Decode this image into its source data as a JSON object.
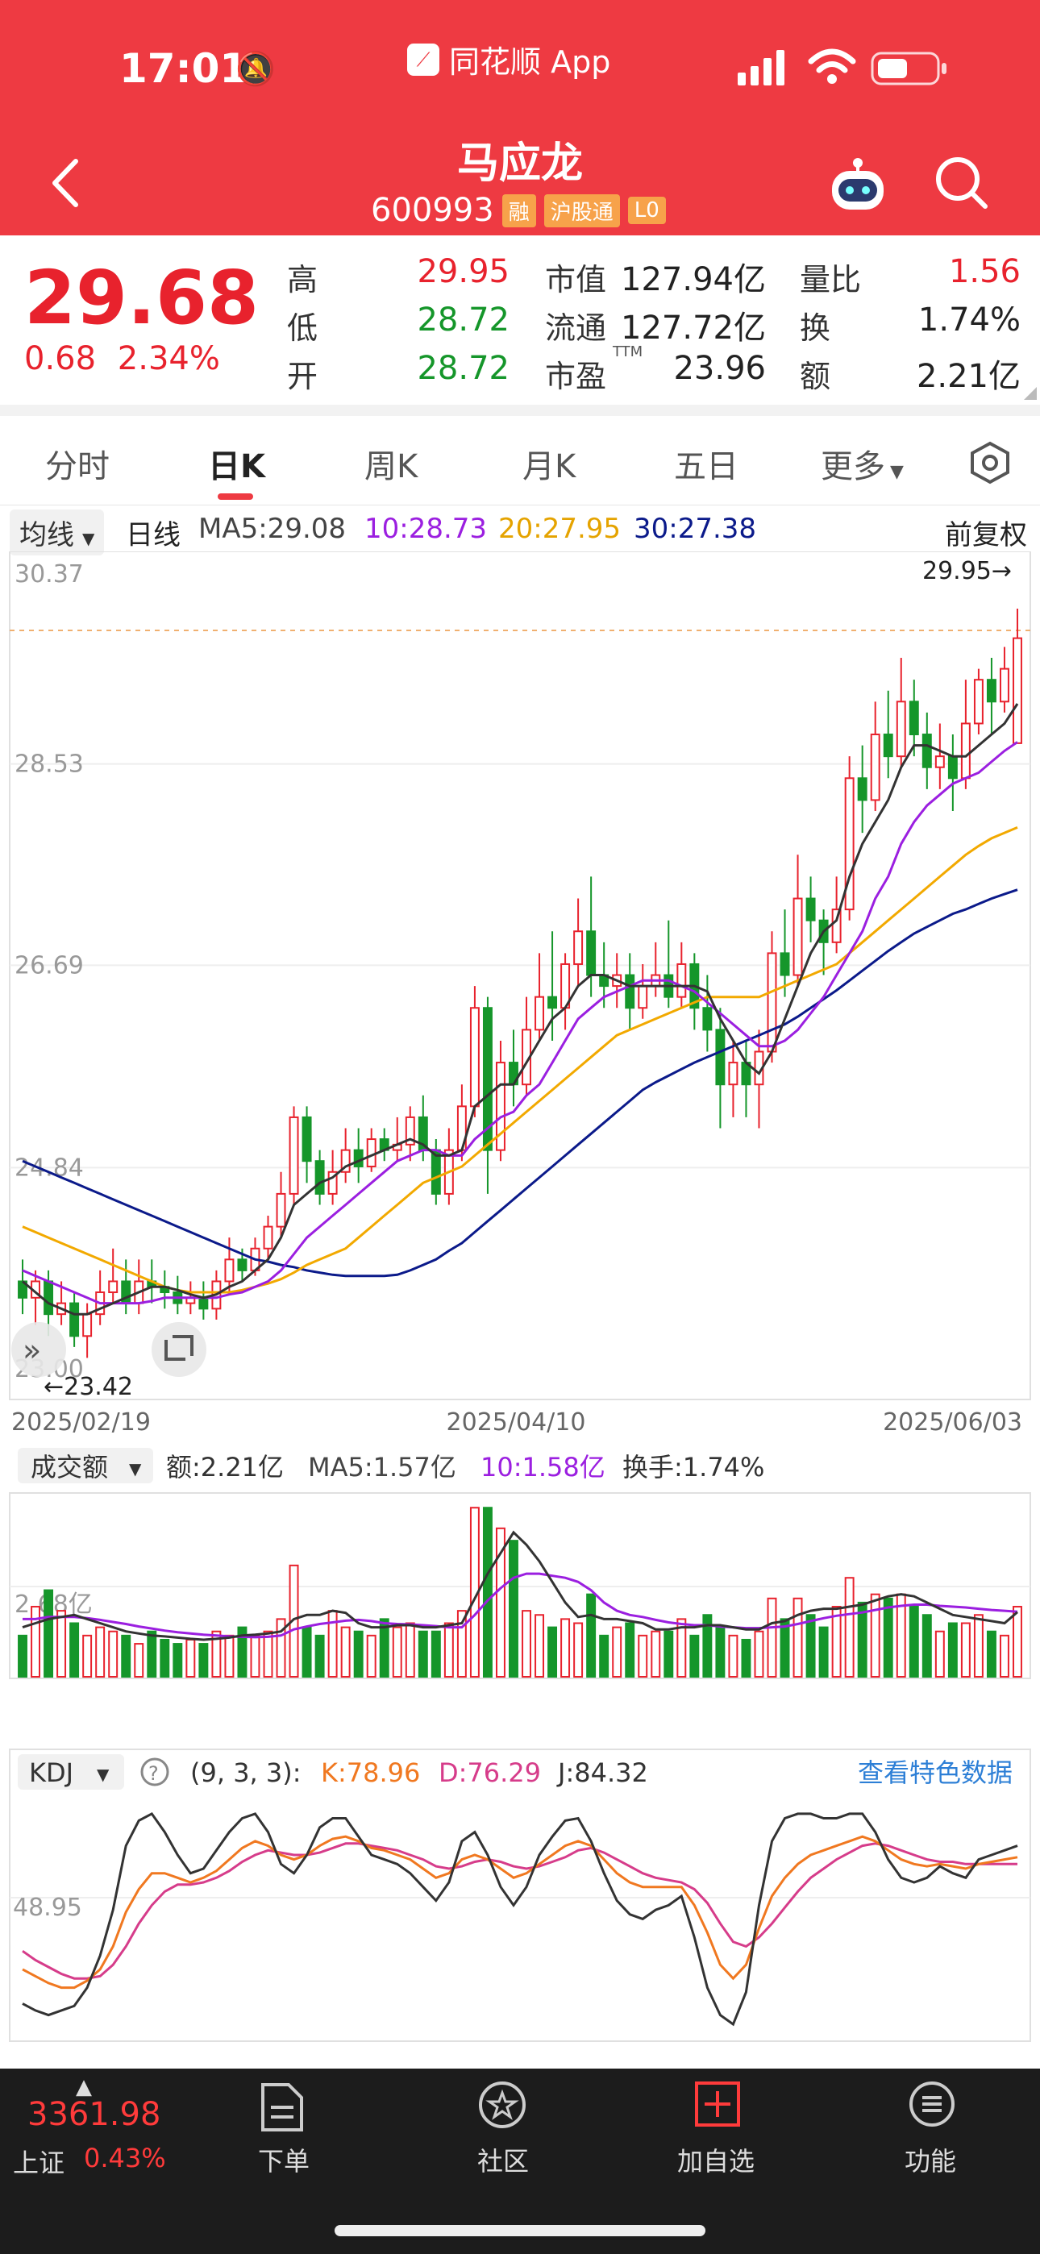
{
  "status": {
    "time": "17:01",
    "app_name": "同花顺 App"
  },
  "stock": {
    "name": "马应龙",
    "code": "600993",
    "tags": [
      "融",
      "沪股通",
      "L0"
    ],
    "price": "29.68",
    "change": "0.68",
    "change_pct": "2.34%",
    "high_label": "高",
    "high": "29.95",
    "low_label": "低",
    "low": "28.72",
    "open_label": "开",
    "open": "28.72",
    "mcap_label": "市值",
    "mcap": "127.94亿",
    "float_label": "流通",
    "float_cap": "127.72亿",
    "pe_label": "市盈",
    "pe_sup": "TTM",
    "pe": "23.96",
    "vr_label": "量比",
    "vr": "1.56",
    "turnover_label": "换",
    "turnover": "1.74%",
    "amount_label": "额",
    "amount": "2.21亿"
  },
  "tabs": [
    "分时",
    "日K",
    "周K",
    "月K",
    "五日",
    "更多"
  ],
  "ma_legend": {
    "dropdown": "均线",
    "period": "日线",
    "ma5": "MA5:29.08",
    "ma10": "10:28.73",
    "ma20": "20:27.95",
    "ma30": "30:27.38",
    "adjust": "前复权"
  },
  "colors": {
    "up": "#e8222d",
    "down": "#15962a",
    "ma5": "#333333",
    "ma10": "#9b1fe0",
    "ma20": "#f2a900",
    "ma30": "#0b1a8a",
    "accent": "#ee3a42"
  },
  "chart_data": [
    {
      "type": "candlestick",
      "title": "",
      "y_ticks": [
        "30.37",
        "28.53",
        "26.69",
        "24.84",
        "23.00"
      ],
      "ylim": [
        23.0,
        30.37
      ],
      "x_ticks": [
        "2025/02/19",
        "2025/04/10",
        "2025/06/03"
      ],
      "max_label": "29.95→",
      "min_label": "←23.42",
      "candles": [
        [
          23.8,
          23.65,
          24.0,
          23.5
        ],
        [
          23.65,
          23.8,
          23.9,
          23.4
        ],
        [
          23.8,
          23.5,
          23.9,
          23.3
        ],
        [
          23.5,
          23.6,
          23.8,
          23.4
        ],
        [
          23.6,
          23.3,
          23.7,
          23.2
        ],
        [
          23.3,
          23.5,
          23.6,
          23.1
        ],
        [
          23.5,
          23.7,
          23.9,
          23.4
        ],
        [
          23.7,
          23.8,
          24.1,
          23.6
        ],
        [
          23.8,
          23.6,
          24.0,
          23.5
        ],
        [
          23.6,
          23.8,
          24.0,
          23.5
        ],
        [
          23.8,
          23.75,
          24.0,
          23.6
        ],
        [
          23.75,
          23.7,
          23.9,
          23.55
        ],
        [
          23.7,
          23.6,
          23.85,
          23.5
        ],
        [
          23.6,
          23.65,
          23.8,
          23.5
        ],
        [
          23.65,
          23.55,
          23.8,
          23.45
        ],
        [
          23.55,
          23.8,
          23.9,
          23.45
        ],
        [
          23.8,
          24.0,
          24.2,
          23.7
        ],
        [
          24.0,
          23.9,
          24.1,
          23.8
        ],
        [
          23.9,
          24.1,
          24.2,
          23.85
        ],
        [
          24.1,
          24.3,
          24.4,
          24.0
        ],
        [
          24.3,
          24.6,
          24.8,
          24.2
        ],
        [
          24.6,
          25.3,
          25.4,
          24.5
        ],
        [
          25.3,
          24.9,
          25.4,
          24.7
        ],
        [
          24.9,
          24.6,
          25.0,
          24.5
        ],
        [
          24.6,
          24.8,
          25.0,
          24.5
        ],
        [
          24.8,
          25.0,
          25.2,
          24.7
        ],
        [
          25.0,
          24.85,
          25.2,
          24.7
        ],
        [
          24.85,
          25.1,
          25.2,
          24.8
        ],
        [
          25.1,
          25.0,
          25.2,
          24.9
        ],
        [
          25.0,
          25.05,
          25.3,
          24.9
        ],
        [
          25.05,
          25.3,
          25.4,
          24.9
        ],
        [
          25.3,
          25.0,
          25.5,
          24.9
        ],
        [
          25.0,
          24.6,
          25.1,
          24.5
        ],
        [
          24.6,
          25.0,
          25.2,
          24.5
        ],
        [
          25.0,
          25.4,
          25.6,
          24.9
        ],
        [
          25.4,
          26.3,
          26.5,
          25.3
        ],
        [
          26.3,
          25.0,
          26.4,
          24.6
        ],
        [
          25.0,
          25.8,
          26.0,
          24.9
        ],
        [
          25.8,
          25.6,
          26.1,
          25.4
        ],
        [
          25.6,
          26.1,
          26.4,
          25.5
        ],
        [
          26.1,
          26.4,
          26.8,
          26.0
        ],
        [
          26.4,
          26.3,
          27.0,
          26.0
        ],
        [
          26.3,
          26.7,
          26.8,
          26.1
        ],
        [
          26.7,
          27.0,
          27.3,
          26.5
        ],
        [
          27.0,
          26.6,
          27.5,
          26.4
        ],
        [
          26.6,
          26.5,
          26.9,
          26.3
        ],
        [
          26.5,
          26.6,
          26.8,
          26.3
        ],
        [
          26.6,
          26.3,
          26.8,
          26.1
        ],
        [
          26.3,
          26.5,
          26.7,
          26.2
        ],
        [
          26.5,
          26.6,
          26.9,
          26.4
        ],
        [
          26.6,
          26.4,
          27.1,
          26.3
        ],
        [
          26.4,
          26.7,
          26.9,
          26.3
        ],
        [
          26.7,
          26.3,
          26.8,
          26.1
        ],
        [
          26.3,
          26.1,
          26.6,
          25.9
        ],
        [
          26.1,
          25.6,
          26.3,
          25.2
        ],
        [
          25.6,
          25.8,
          26.0,
          25.3
        ],
        [
          25.8,
          25.6,
          26.0,
          25.3
        ],
        [
          25.6,
          25.9,
          26.1,
          25.2
        ],
        [
          25.9,
          26.8,
          27.0,
          25.8
        ],
        [
          26.8,
          26.6,
          27.2,
          26.4
        ],
        [
          26.6,
          27.3,
          27.7,
          26.5
        ],
        [
          27.3,
          27.1,
          27.5,
          26.9
        ],
        [
          27.1,
          26.9,
          27.2,
          26.6
        ],
        [
          26.9,
          27.2,
          27.5,
          26.8
        ],
        [
          27.2,
          28.4,
          28.6,
          27.1
        ],
        [
          28.4,
          28.2,
          28.7,
          27.9
        ],
        [
          28.2,
          28.8,
          29.1,
          28.1
        ],
        [
          28.8,
          28.6,
          29.2,
          28.4
        ],
        [
          28.6,
          29.1,
          29.5,
          28.5
        ],
        [
          29.1,
          28.8,
          29.3,
          28.6
        ],
        [
          28.8,
          28.5,
          29.0,
          28.3
        ],
        [
          28.5,
          28.6,
          28.9,
          28.3
        ],
        [
          28.6,
          28.4,
          28.8,
          28.1
        ],
        [
          28.4,
          28.9,
          29.3,
          28.3
        ],
        [
          28.9,
          29.3,
          29.4,
          28.8
        ],
        [
          29.3,
          29.1,
          29.5,
          28.8
        ],
        [
          29.1,
          29.4,
          29.6,
          29.0
        ],
        [
          28.72,
          29.68,
          29.95,
          28.72
        ]
      ],
      "ma5": [
        23.8,
        23.7,
        23.6,
        23.55,
        23.5,
        23.5,
        23.55,
        23.6,
        23.65,
        23.7,
        23.75,
        23.75,
        23.72,
        23.68,
        23.65,
        23.68,
        23.75,
        23.8,
        23.9,
        24.0,
        24.2,
        24.5,
        24.6,
        24.7,
        24.75,
        24.85,
        24.9,
        24.95,
        25.0,
        25.05,
        25.1,
        25.05,
        24.95,
        24.95,
        25.0,
        25.4,
        25.5,
        25.6,
        25.6,
        25.8,
        26.0,
        26.2,
        26.3,
        26.5,
        26.6,
        26.6,
        26.55,
        26.5,
        26.5,
        26.5,
        26.5,
        26.5,
        26.5,
        26.45,
        26.2,
        26.0,
        25.8,
        25.7,
        25.9,
        26.2,
        26.5,
        26.8,
        27.0,
        27.1,
        27.5,
        27.8,
        28.0,
        28.2,
        28.5,
        28.7,
        28.7,
        28.65,
        28.6,
        28.6,
        28.7,
        28.8,
        28.9,
        29.08
      ],
      "ma10": [
        23.9,
        23.85,
        23.8,
        23.75,
        23.7,
        23.65,
        23.6,
        23.6,
        23.6,
        23.6,
        23.62,
        23.65,
        23.65,
        23.65,
        23.65,
        23.65,
        23.68,
        23.7,
        23.75,
        23.8,
        23.9,
        24.05,
        24.2,
        24.3,
        24.4,
        24.5,
        24.6,
        24.7,
        24.8,
        24.9,
        24.95,
        25.0,
        25.0,
        24.95,
        24.95,
        25.1,
        25.2,
        25.3,
        25.35,
        25.5,
        25.6,
        25.8,
        26.0,
        26.2,
        26.3,
        26.4,
        26.45,
        26.5,
        26.55,
        26.55,
        26.55,
        26.5,
        26.45,
        26.35,
        26.25,
        26.15,
        26.05,
        25.95,
        25.95,
        26.0,
        26.1,
        26.25,
        26.4,
        26.6,
        26.8,
        27.0,
        27.3,
        27.5,
        27.8,
        28.0,
        28.15,
        28.25,
        28.35,
        28.4,
        28.45,
        28.55,
        28.65,
        28.73
      ],
      "ma20": [
        24.3,
        24.25,
        24.2,
        24.15,
        24.1,
        24.05,
        24.0,
        23.95,
        23.9,
        23.85,
        23.8,
        23.75,
        23.72,
        23.7,
        23.7,
        23.7,
        23.7,
        23.72,
        23.75,
        23.78,
        23.82,
        23.88,
        23.95,
        24.0,
        24.05,
        24.1,
        24.2,
        24.3,
        24.4,
        24.5,
        24.6,
        24.7,
        24.75,
        24.8,
        24.85,
        24.95,
        25.05,
        25.15,
        25.25,
        25.35,
        25.45,
        25.55,
        25.65,
        25.75,
        25.85,
        25.95,
        26.05,
        26.1,
        26.15,
        26.2,
        26.25,
        26.3,
        26.35,
        26.4,
        26.4,
        26.4,
        26.4,
        26.4,
        26.45,
        26.5,
        26.55,
        26.6,
        26.65,
        26.7,
        26.8,
        26.9,
        27.0,
        27.1,
        27.2,
        27.3,
        27.4,
        27.5,
        27.6,
        27.7,
        27.78,
        27.85,
        27.9,
        27.95
      ],
      "ma30": [
        24.9,
        24.85,
        24.8,
        24.75,
        24.7,
        24.65,
        24.6,
        24.55,
        24.5,
        24.45,
        24.4,
        24.35,
        24.3,
        24.25,
        24.2,
        24.15,
        24.1,
        24.05,
        24.0,
        23.98,
        23.95,
        23.93,
        23.9,
        23.88,
        23.86,
        23.85,
        23.85,
        23.85,
        23.85,
        23.86,
        23.9,
        23.95,
        24.0,
        24.08,
        24.15,
        24.25,
        24.35,
        24.45,
        24.55,
        24.65,
        24.75,
        24.85,
        24.95,
        25.05,
        25.15,
        25.25,
        25.35,
        25.45,
        25.55,
        25.62,
        25.68,
        25.74,
        25.8,
        25.85,
        25.9,
        25.95,
        26.0,
        26.05,
        26.1,
        26.15,
        26.22,
        26.3,
        26.38,
        26.46,
        26.55,
        26.64,
        26.73,
        26.82,
        26.9,
        26.98,
        27.04,
        27.1,
        27.16,
        27.2,
        27.25,
        27.3,
        27.34,
        27.38
      ]
    },
    {
      "type": "bar",
      "title": "",
      "dropdown": "成交额",
      "legend": {
        "amount": "额:2.21亿",
        "ma5": "MA5:1.57亿",
        "ma10": "10:1.58亿",
        "turnover": "换手:1.74%"
      },
      "y_tick": "2.68亿",
      "values": [
        1.0,
        1.7,
        2.1,
        1.6,
        1.3,
        1.0,
        1.2,
        1.1,
        1.0,
        0.8,
        1.1,
        0.9,
        0.8,
        0.9,
        0.8,
        1.1,
        1.0,
        1.2,
        1.0,
        1.1,
        1.4,
        2.7,
        1.2,
        1.0,
        1.6,
        1.2,
        1.1,
        1.0,
        1.4,
        1.2,
        1.3,
        1.1,
        1.1,
        1.3,
        1.6,
        4.1,
        4.1,
        3.6,
        3.3,
        1.6,
        1.5,
        1.2,
        1.4,
        1.3,
        2.0,
        1.0,
        1.2,
        1.3,
        1.0,
        1.1,
        1.1,
        1.4,
        1.0,
        1.5,
        1.2,
        1.0,
        0.9,
        1.1,
        1.9,
        1.4,
        1.9,
        1.5,
        1.2,
        1.7,
        2.4,
        1.8,
        2.0,
        1.9,
        2.0,
        1.7,
        1.5,
        1.1,
        1.3,
        1.3,
        1.5,
        1.1,
        1.0,
        1.7
      ],
      "ma5": [
        1.2,
        1.3,
        1.4,
        1.45,
        1.5,
        1.4,
        1.3,
        1.2,
        1.1,
        1.05,
        1.0,
        0.98,
        0.95,
        0.92,
        0.9,
        0.92,
        0.95,
        1.0,
        1.02,
        1.05,
        1.1,
        1.4,
        1.5,
        1.5,
        1.6,
        1.55,
        1.3,
        1.2,
        1.2,
        1.25,
        1.25,
        1.2,
        1.2,
        1.25,
        1.3,
        1.9,
        2.5,
        3.0,
        3.5,
        3.2,
        2.8,
        2.3,
        1.8,
        1.45,
        1.5,
        1.4,
        1.4,
        1.35,
        1.3,
        1.15,
        1.15,
        1.2,
        1.2,
        1.25,
        1.25,
        1.2,
        1.15,
        1.15,
        1.3,
        1.35,
        1.5,
        1.6,
        1.65,
        1.65,
        1.7,
        1.75,
        1.85,
        1.95,
        2.0,
        1.95,
        1.8,
        1.65,
        1.5,
        1.45,
        1.4,
        1.35,
        1.3,
        1.57
      ],
      "ma10": [
        1.4,
        1.4,
        1.45,
        1.45,
        1.45,
        1.42,
        1.38,
        1.33,
        1.28,
        1.22,
        1.17,
        1.12,
        1.08,
        1.05,
        1.02,
        1.0,
        0.98,
        0.97,
        0.96,
        0.97,
        1.0,
        1.15,
        1.22,
        1.28,
        1.32,
        1.36,
        1.38,
        1.35,
        1.3,
        1.28,
        1.27,
        1.25,
        1.23,
        1.2,
        1.2,
        1.5,
        1.85,
        2.15,
        2.4,
        2.5,
        2.5,
        2.45,
        2.4,
        2.3,
        2.1,
        1.8,
        1.6,
        1.5,
        1.45,
        1.38,
        1.32,
        1.28,
        1.25,
        1.25,
        1.22,
        1.2,
        1.18,
        1.18,
        1.2,
        1.22,
        1.28,
        1.35,
        1.42,
        1.48,
        1.52,
        1.56,
        1.62,
        1.68,
        1.72,
        1.75,
        1.75,
        1.72,
        1.7,
        1.68,
        1.65,
        1.62,
        1.6,
        1.58
      ]
    },
    {
      "type": "line",
      "title": "",
      "dropdown": "KDJ",
      "params": "(9, 3, 3):",
      "legend": {
        "k": "K:78.96",
        "d": "D:76.29",
        "j": "J:84.32"
      },
      "link": "查看特色数据",
      "y_tick": "48.95",
      "k": [
        30,
        27,
        24,
        22,
        22,
        25,
        30,
        40,
        55,
        65,
        72,
        72,
        70,
        68,
        70,
        73,
        78,
        83,
        86,
        84,
        80,
        78,
        80,
        84,
        87,
        88,
        86,
        83,
        82,
        80,
        78,
        74,
        70,
        72,
        78,
        80,
        78,
        74,
        70,
        72,
        76,
        80,
        84,
        86,
        84,
        78,
        72,
        68,
        66,
        66,
        66,
        66,
        58,
        46,
        32,
        26,
        32,
        48,
        62,
        70,
        76,
        80,
        82,
        84,
        86,
        88,
        86,
        82,
        78,
        76,
        75,
        76,
        75,
        74,
        76,
        77,
        78,
        79
      ],
      "d": [
        38,
        34,
        31,
        28,
        26,
        26,
        27,
        32,
        40,
        50,
        58,
        64,
        67,
        67,
        68,
        70,
        73,
        77,
        80,
        82,
        81,
        80,
        80,
        81,
        83,
        85,
        85,
        84,
        83,
        82,
        80,
        78,
        75,
        74,
        75,
        77,
        78,
        77,
        75,
        74,
        75,
        77,
        79,
        82,
        83,
        81,
        78,
        75,
        72,
        70,
        69,
        68,
        65,
        59,
        50,
        42,
        40,
        44,
        50,
        57,
        64,
        70,
        74,
        78,
        81,
        84,
        85,
        84,
        82,
        80,
        78,
        77,
        77,
        76,
        76,
        76,
        76,
        76
      ],
      "j": [
        15,
        12,
        10,
        12,
        14,
        22,
        36,
        56,
        84,
        95,
        98,
        90,
        80,
        72,
        74,
        82,
        90,
        96,
        98,
        90,
        76,
        72,
        80,
        92,
        96,
        96,
        88,
        80,
        78,
        76,
        72,
        66,
        60,
        68,
        86,
        90,
        80,
        66,
        58,
        66,
        80,
        88,
        95,
        96,
        86,
        72,
        60,
        54,
        52,
        56,
        58,
        62,
        44,
        22,
        10,
        6,
        20,
        58,
        86,
        96,
        98,
        98,
        96,
        96,
        98,
        98,
        90,
        78,
        70,
        68,
        70,
        75,
        72,
        70,
        78,
        80,
        82,
        84
      ]
    }
  ],
  "bottom_nav": {
    "index_value": "3361.98",
    "index_name": "上证",
    "index_pct": "0.43%",
    "items": [
      "下单",
      "社区",
      "加自选",
      "功能"
    ]
  }
}
